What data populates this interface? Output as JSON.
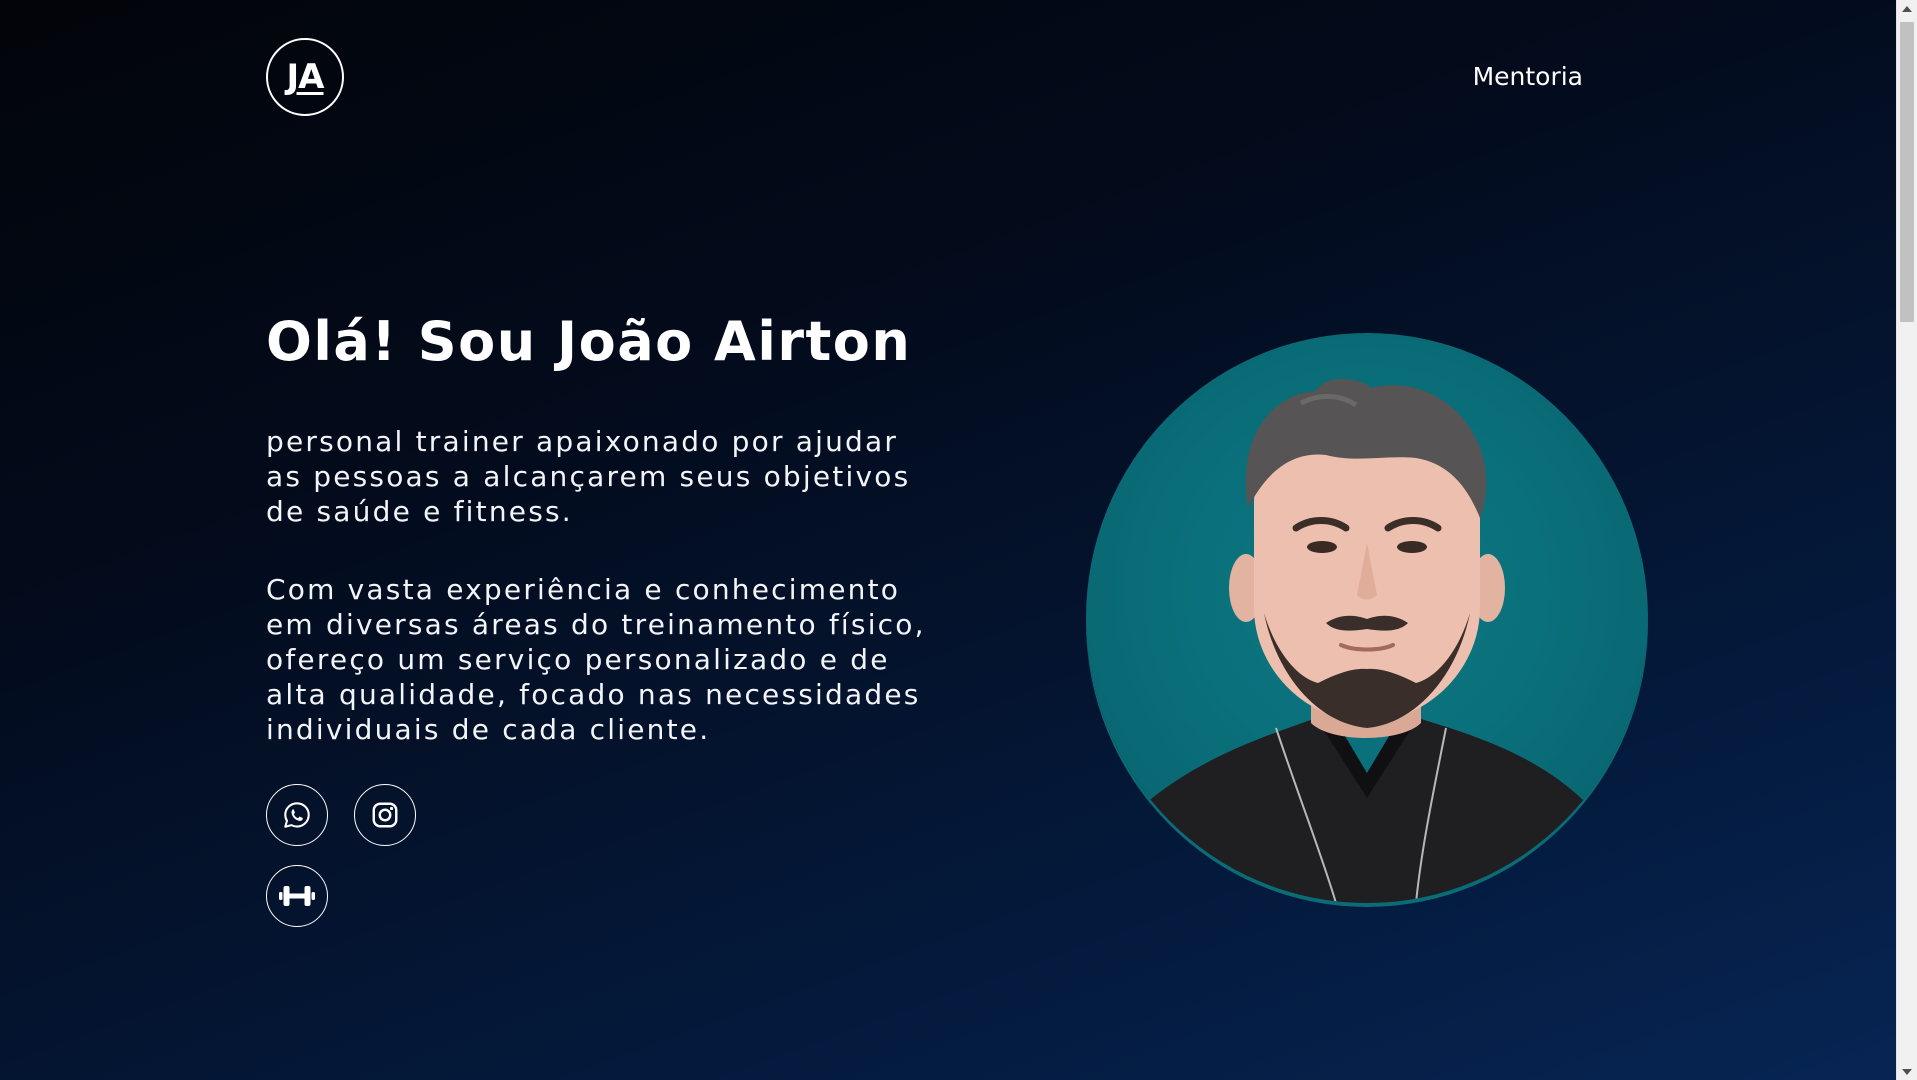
{
  "header": {
    "logo_text": "JA",
    "nav_link": "Mentoria"
  },
  "hero": {
    "title": "Olá! Sou João Airton",
    "paragraph_1_lines": [
      "personal trainer apaixonado por ajudar",
      "as pessoas a alcançarem seus objetivos",
      "de saúde e fitness."
    ],
    "paragraph_2_lines": [
      "Com vasta experiência e conhecimento",
      "em diversas áreas do treinamento físico,",
      "ofereço um serviço personalizado e de",
      "alta qualidade, focado nas necessidades",
      "individuais de cada cliente."
    ]
  },
  "social": {
    "buttons": [
      {
        "icon": "whatsapp-icon"
      },
      {
        "icon": "instagram-icon"
      },
      {
        "icon": "dumbbell-icon"
      }
    ]
  },
  "profile_photo": {
    "background_color": "#0a6f7a"
  },
  "colors": {
    "background_top": "#020409",
    "background_bottom": "#072554",
    "text": "#ffffff",
    "photo_bg": "#0a6f7a"
  }
}
